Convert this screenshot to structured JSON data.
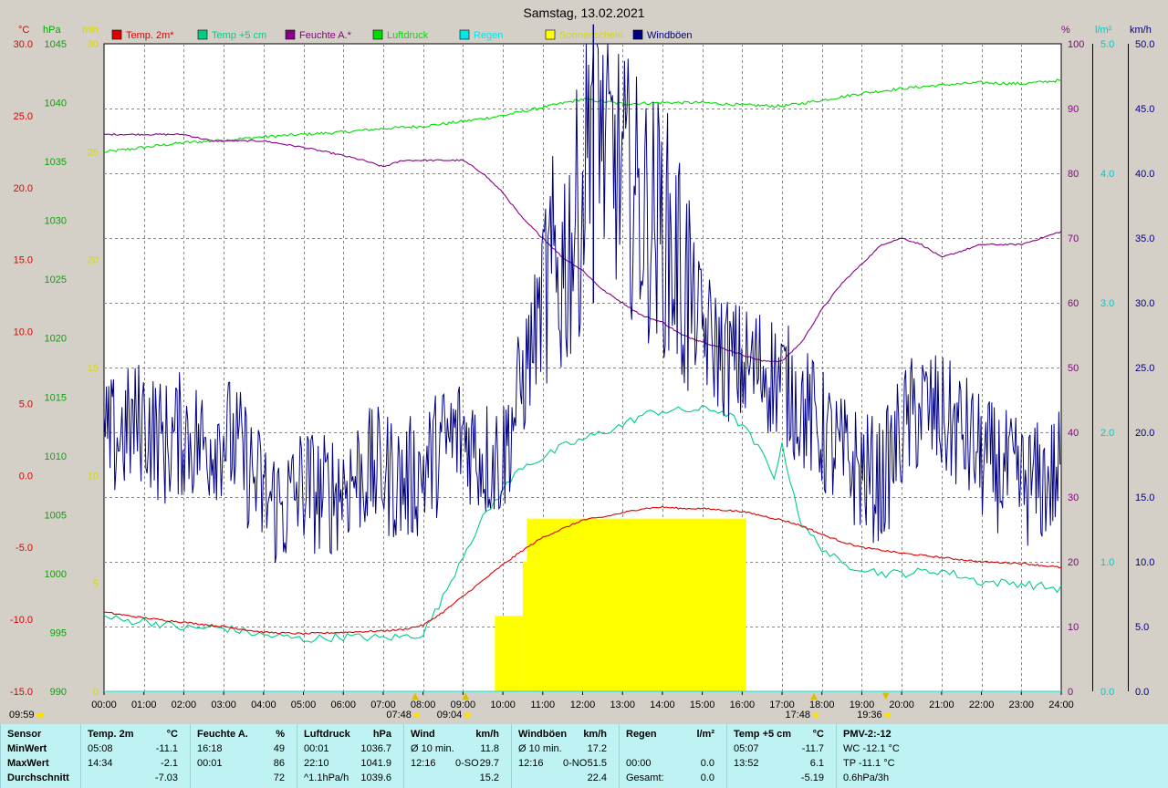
{
  "title": "Samstag, 13.02.2021",
  "colors": {
    "background": "#d4d0c8",
    "plot_bg": "#ffffff",
    "temp2m": "#dd0000",
    "temp5cm": "#00cc88",
    "humidity": "#880088",
    "pressure": "#00dd00",
    "rain": "#00e8e8",
    "sunshine": "#ffff00",
    "gusts": "#000080",
    "panel": "#bff2f2"
  },
  "legend": [
    {
      "label": "Temp. 2m*",
      "color": "#dd0000"
    },
    {
      "label": "Temp +5 cm",
      "color": "#00cc88"
    },
    {
      "label": "Feuchte A.*",
      "color": "#880088"
    },
    {
      "label": "Luftdruck",
      "color": "#00dd00"
    },
    {
      "label": "Regen",
      "color": "#00e8e8"
    },
    {
      "label": "Sonnenschein",
      "color": "#ffff00"
    },
    {
      "label": "Windböen",
      "color": "#000080"
    }
  ],
  "axes": {
    "temp": {
      "unit": "°C",
      "ticks": [
        "30.0",
        "25.0",
        "20.0",
        "15.0",
        "10.0",
        "5.0",
        "0.0",
        "-5.0",
        "-10.0",
        "-15.0"
      ],
      "range": [
        -15,
        30
      ]
    },
    "pressure": {
      "unit": "hPa",
      "ticks": [
        "1045",
        "1040",
        "1035",
        "1030",
        "1025",
        "1020",
        "1015",
        "1010",
        "1005",
        "1000",
        "995",
        "990"
      ],
      "range": [
        990,
        1045
      ]
    },
    "minutes": {
      "unit": "min",
      "ticks": [
        "30",
        "25",
        "20",
        "15",
        "10",
        "5",
        "0"
      ],
      "range": [
        0,
        30
      ]
    },
    "humidity": {
      "unit": "%",
      "ticks": [
        "100",
        "90",
        "80",
        "70",
        "60",
        "50",
        "40",
        "30",
        "20",
        "10",
        "0"
      ],
      "range": [
        0,
        100
      ]
    },
    "rain": {
      "unit": "l/m²",
      "ticks": [
        "5.0",
        "4.0",
        "3.0",
        "2.0",
        "1.0",
        "0.0"
      ],
      "range": [
        0,
        5
      ]
    },
    "wind": {
      "unit": "km/h",
      "ticks": [
        "50.0",
        "45.0",
        "40.0",
        "35.0",
        "30.0",
        "25.0",
        "20.0",
        "15.0",
        "10.0",
        "5.0",
        "0.0"
      ],
      "range": [
        0,
        50
      ]
    },
    "x_ticks": [
      "00:00",
      "01:00",
      "02:00",
      "03:00",
      "04:00",
      "05:00",
      "06:00",
      "07:00",
      "08:00",
      "09:00",
      "10:00",
      "11:00",
      "12:00",
      "13:00",
      "14:00",
      "15:00",
      "16:00",
      "17:00",
      "18:00",
      "19:00",
      "20:00",
      "21:00",
      "22:00",
      "23:00",
      "24:00"
    ]
  },
  "markers": {
    "left_time": "09:59",
    "sunrise": "07:48",
    "moonrise": "09:04",
    "sunset": "17:48",
    "moonset": "19:36"
  },
  "chart_data": {
    "type": "line",
    "title": "Samstag, 13.02.2021",
    "x_unit": "hours",
    "series": [
      {
        "name": "Temp. 2m*",
        "axis": "temp",
        "x": [
          0,
          0.5,
          1,
          2,
          3,
          4,
          5,
          6,
          7,
          7.5,
          8,
          8.5,
          9,
          9.5,
          10,
          10.5,
          11,
          11.5,
          12,
          12.5,
          13,
          13.5,
          14,
          14.5,
          15,
          15.5,
          16,
          16.5,
          17,
          17.5,
          18,
          18.5,
          19,
          19.5,
          20,
          21,
          22,
          23,
          24
        ],
        "values": [
          -9.5,
          -9.7,
          -9.9,
          -10.2,
          -10.5,
          -10.9,
          -11.0,
          -10.9,
          -10.8,
          -10.7,
          -10.4,
          -9.5,
          -8.4,
          -7.3,
          -6.2,
          -5.2,
          -4.3,
          -3.7,
          -3.1,
          -2.9,
          -2.6,
          -2.3,
          -2.2,
          -2.3,
          -2.3,
          -2.4,
          -2.5,
          -2.8,
          -3.1,
          -3.5,
          -4.1,
          -4.6,
          -5.0,
          -5.2,
          -5.4,
          -5.7,
          -6.0,
          -6.1,
          -6.4
        ]
      },
      {
        "name": "Temp +5 cm",
        "axis": "temp",
        "x": [
          0,
          0.5,
          1,
          2,
          3,
          4,
          4.8,
          5,
          6,
          7,
          7.5,
          8,
          8.5,
          9,
          9.5,
          10,
          10.5,
          11,
          11.5,
          12,
          12.5,
          13,
          13.5,
          14,
          14.5,
          15,
          15.5,
          16,
          16.5,
          16.8,
          17,
          17.5,
          18,
          18.5,
          19,
          19.5,
          20,
          21,
          22,
          23,
          24
        ],
        "values": [
          -9.8,
          -10.1,
          -10.1,
          -10.6,
          -10.6,
          -11.1,
          -11.3,
          -11.4,
          -11.2,
          -11.3,
          -11.2,
          -11.0,
          -8.5,
          -5.5,
          -3.0,
          -1.0,
          0.7,
          1.2,
          2.0,
          2.5,
          3.0,
          3.5,
          4.2,
          4.5,
          4.5,
          4.6,
          4.5,
          3.5,
          1.5,
          0,
          2,
          -3.5,
          -5.0,
          -6.2,
          -6.4,
          -6.8,
          -6.8,
          -6.6,
          -7.4,
          -7.5,
          -7.9
        ]
      },
      {
        "name": "Feuchte A.*",
        "axis": "humidity",
        "x": [
          0,
          1,
          2,
          2.7,
          3,
          4,
          5,
          5.8,
          6.5,
          7,
          7.5,
          8,
          9,
          9.5,
          10,
          10.5,
          11,
          11.5,
          12,
          12.5,
          13,
          13.5,
          14,
          14.5,
          15,
          15.5,
          16,
          16.5,
          17,
          17.5,
          18,
          18.5,
          19,
          19.5,
          20,
          20.5,
          21,
          21.5,
          22,
          22.5,
          23,
          23.5,
          24
        ],
        "values": [
          86,
          86,
          86,
          85,
          85,
          85,
          84,
          83,
          82,
          81,
          82,
          82,
          82,
          80,
          77,
          73,
          70,
          67,
          65,
          62,
          60,
          58,
          57,
          55,
          54,
          53,
          52,
          51,
          51,
          54,
          59,
          63,
          66,
          69,
          70,
          69,
          67,
          68,
          69,
          69,
          69,
          70,
          71
        ]
      },
      {
        "name": "Luftdruck",
        "axis": "pressure",
        "x": [
          0,
          1,
          2,
          3,
          4,
          5,
          6,
          7,
          8,
          9,
          10,
          11,
          12,
          13,
          14,
          15,
          16,
          17,
          18,
          19,
          20,
          21,
          22,
          23,
          24
        ],
        "values": [
          1035.8,
          1036.2,
          1036.6,
          1036.8,
          1037.1,
          1037.3,
          1037.5,
          1037.8,
          1038.0,
          1038.4,
          1038.9,
          1039.6,
          1040.3,
          1039.9,
          1040.0,
          1040.0,
          1039.8,
          1039.7,
          1040.2,
          1040.8,
          1041.2,
          1041.5,
          1041.7,
          1041.6,
          1041.9
        ]
      },
      {
        "name": "Regen",
        "axis": "rain",
        "x": [
          0,
          24
        ],
        "values": [
          0,
          0
        ]
      },
      {
        "name": "Sonnenschein",
        "axis": "minutes",
        "type": "bar",
        "x_start": [
          9.8,
          10.5,
          10.6
        ],
        "x_end": [
          10.5,
          10.6,
          16.1
        ],
        "values": [
          3.5,
          6,
          8
        ]
      },
      {
        "name": "Windböen",
        "axis": "wind",
        "x": [
          0,
          0.5,
          1,
          1.5,
          2,
          2.5,
          3,
          3.5,
          4,
          4.5,
          5,
          5.5,
          6,
          6.5,
          7,
          7.5,
          8,
          8.5,
          9,
          9.5,
          10,
          10.5,
          11,
          11.5,
          12,
          12.3,
          12.5,
          13,
          13.5,
          14,
          14.5,
          15,
          15.5,
          16,
          16.5,
          17,
          17.5,
          18,
          18.5,
          19,
          19.5,
          20,
          20.5,
          21,
          21.5,
          22,
          22.5,
          23,
          23.5,
          24
        ],
        "values": [
          19,
          20,
          21,
          19,
          20,
          19,
          20,
          18,
          15,
          14,
          16,
          15,
          16,
          17,
          17,
          16,
          17,
          19,
          20,
          18,
          18,
          24,
          30,
          33,
          38,
          51.5,
          42,
          40,
          37,
          36,
          32,
          28,
          26,
          25,
          25,
          24,
          22,
          20,
          18,
          17,
          16,
          20,
          22,
          21,
          20,
          18,
          17,
          16,
          16,
          17
        ]
      }
    ]
  },
  "stats": {
    "headers": [
      {
        "label": "Sensor",
        "unit": ""
      },
      {
        "label": "Temp. 2m",
        "unit": "°C"
      },
      {
        "label": "Feuchte A.",
        "unit": "%"
      },
      {
        "label": "Luftdruck",
        "unit": "hPa"
      },
      {
        "label": "Wind",
        "unit": "km/h"
      },
      {
        "label": "Windböen",
        "unit": "km/h"
      },
      {
        "label": "Regen",
        "unit": "l/m²"
      },
      {
        "label": "Temp +5 cm",
        "unit": "°C"
      },
      {
        "label": "PMV-2:-12",
        "unit": ""
      }
    ],
    "rows": [
      {
        "label": "MinWert",
        "cells": [
          [
            "05:08",
            "",
            "-11.1"
          ],
          [
            "16:18",
            "",
            "49"
          ],
          [
            "00:01",
            "",
            "1036.7"
          ],
          [
            "Ø 10 min.",
            "",
            "11.8"
          ],
          [
            "Ø 10 min.",
            "",
            "17.2"
          ],
          [
            "",
            "",
            ""
          ],
          [
            "05:07",
            "",
            "-11.7"
          ],
          [
            "WC -12.1 °C",
            "",
            ""
          ]
        ]
      },
      {
        "label": "MaxWert",
        "cells": [
          [
            "14:34",
            "",
            "-2.1"
          ],
          [
            "00:01",
            "",
            "86"
          ],
          [
            "22:10",
            "",
            "1041.9"
          ],
          [
            "12:16",
            "0-SO",
            "29.7"
          ],
          [
            "12:16",
            "0-NO",
            "51.5"
          ],
          [
            "00:00",
            "",
            "0.0"
          ],
          [
            "13:52",
            "",
            "6.1"
          ],
          [
            "TP -11.1 °C",
            "",
            ""
          ]
        ]
      },
      {
        "label": "Durchschnitt",
        "cells": [
          [
            "",
            "",
            "-7.03"
          ],
          [
            "",
            "",
            "72"
          ],
          [
            "^1.1hPa/h",
            "",
            "1039.6"
          ],
          [
            "",
            "",
            "15.2"
          ],
          [
            "",
            "",
            "22.4"
          ],
          [
            "Gesamt:",
            "",
            "0.0"
          ],
          [
            "",
            "",
            "-5.19"
          ],
          [
            "0.6hPa/3h",
            "",
            ""
          ]
        ]
      }
    ]
  }
}
